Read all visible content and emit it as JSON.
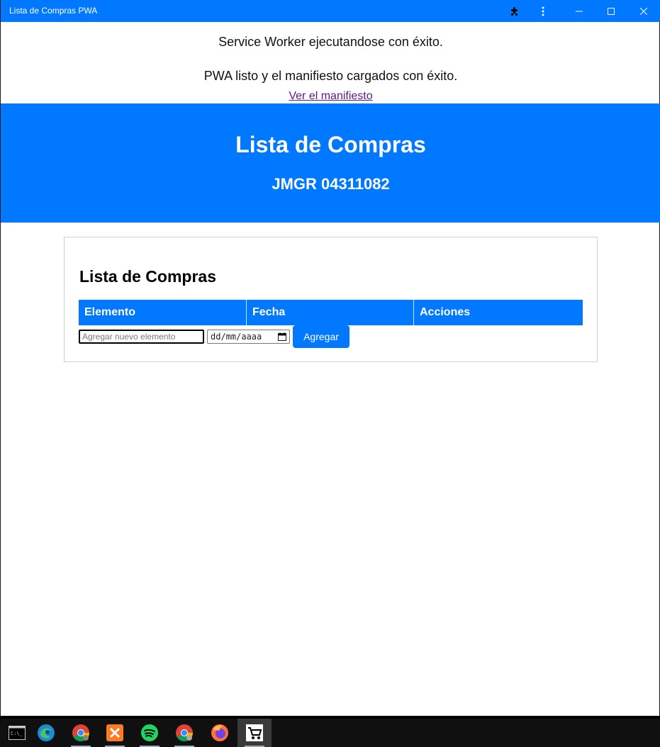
{
  "window": {
    "title": "Lista de Compras PWA",
    "buttons": [
      "extensions-icon",
      "menu-icon",
      "minimize-icon",
      "maximize-icon",
      "close-icon"
    ]
  },
  "status": {
    "service_worker": "Service Worker ejecutandose con éxito.",
    "pwa_ready": "PWA listo y el manifiesto cargados con éxito.",
    "manifest_link": "Ver el manifiesto"
  },
  "header": {
    "title": "Lista de Compras",
    "subtitle": "JMGR 04311082"
  },
  "list": {
    "heading": "Lista de Compras",
    "columns": [
      "Elemento",
      "Fecha",
      "Acciones"
    ],
    "item_placeholder": "Agregar nuevo elemento",
    "date_placeholder": "dd/mm/aaaa",
    "add_label": "Agregar"
  },
  "taskbar": {
    "apps": [
      "terminal-icon",
      "edge-icon",
      "chrome-icon",
      "xampp-icon",
      "spotify-icon",
      "chrome-profile-icon",
      "firefox-icon",
      "shopping-cart-pwa-icon"
    ]
  },
  "colors": {
    "accent": "#0078ff",
    "link": "#551a8b"
  }
}
